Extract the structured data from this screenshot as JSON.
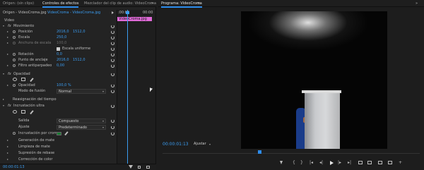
{
  "left_tabs": [
    "Origen: (sin clips)",
    "Controles de efectos",
    "Mezclador del clip de audio: VideoCroma"
  ],
  "left_panel_menu": "»",
  "clip_header": {
    "master": "Origen - VideoCroma.jpg",
    "separator": "·",
    "sequence": "VideoCroma - VideoCroma.jpg"
  },
  "mini_timeline": {
    "start_tc": ":00:00",
    "end_tc": "00:00",
    "clip_label": "VideoCroma.jpg"
  },
  "sections": {
    "video": "Video",
    "movimiento": "Movimiento",
    "opacidad": "Opacidad",
    "reasignacion": "Reasignación del tiempo",
    "incrustacion": "Incrustación ultra"
  },
  "fx_label": "fx",
  "movimiento": {
    "posicion": {
      "label": "Posición",
      "x": "2016,0",
      "y": "1512,0"
    },
    "escala": {
      "label": "Escala",
      "value": "250,0"
    },
    "anchura": {
      "label": "Anchura de escala",
      "value": "100,0"
    },
    "uniforme": {
      "label": "Escala uniforme"
    },
    "rotacion": {
      "label": "Rotación",
      "value": "0,0"
    },
    "anclaje": {
      "label": "Punto de anclaje",
      "x": "2016,0",
      "y": "1512,0"
    },
    "antiparpadeo": {
      "label": "Filtro antiparpadeo",
      "value": "0,00"
    }
  },
  "opacidad": {
    "opacidad": {
      "label": "Opacidad",
      "value": "100,0 %"
    },
    "fusion": {
      "label": "Modo de fusión",
      "value": "Normal"
    }
  },
  "incrustacion": {
    "salida": {
      "label": "Salida",
      "value": "Compuesto"
    },
    "ajuste": {
      "label": "Ajuste",
      "value": "Predeterminado"
    },
    "color": {
      "label": "Incrustación por croma"
    },
    "generacion": "Generación de mate",
    "limpieza": "Limpieza de mate",
    "supresion": "Supresión de rebase",
    "correccion": "Corrección de color"
  },
  "left_footer_tc": "00:00:01:13",
  "program": {
    "title": "Programa: VideoCroma",
    "menu": "≡",
    "panel_menu": "»",
    "timecode": "00:00:01:13",
    "fit": "Ajustar"
  },
  "colors": {
    "accent": "#2d8ceb",
    "clip_pink": "#e06ad8",
    "key_color": "#1a7a32"
  }
}
